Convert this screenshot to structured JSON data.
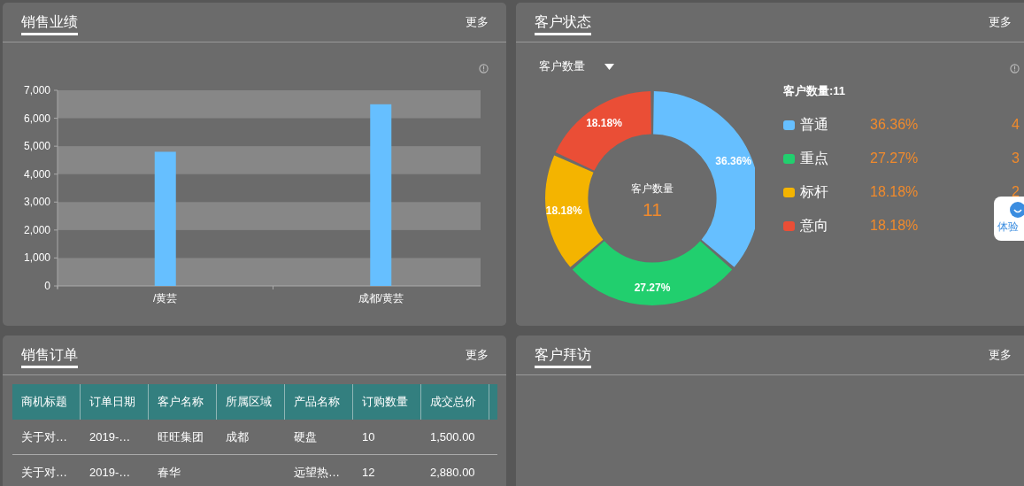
{
  "sales_performance": {
    "title": "销售业绩",
    "more": "更多",
    "chart_data": {
      "type": "bar",
      "categories": [
        "/黄芸",
        "成都/黄芸"
      ],
      "series": [
        {
          "color": "#66bfff",
          "values": [
            4800,
            6500
          ]
        }
      ],
      "ylim": [
        0,
        7000
      ],
      "yticks": [
        {
          "value": 0,
          "label": "0"
        },
        {
          "value": 1000,
          "label": "1,000"
        },
        {
          "value": 2000,
          "label": "2,000"
        },
        {
          "value": 3000,
          "label": "3,000"
        },
        {
          "value": 4000,
          "label": "4,000"
        },
        {
          "value": 5000,
          "label": "5,000"
        },
        {
          "value": 6000,
          "label": "6,000"
        },
        {
          "value": 7000,
          "label": "7,000"
        }
      ]
    }
  },
  "customer_status": {
    "title": "客户状态",
    "more": "更多",
    "dropdown": "客户数量",
    "center_label": "客户数量",
    "center_value": "11",
    "legend_title": "客户数量:11",
    "chart_data": {
      "type": "donut",
      "series": [
        {
          "values": [
            36.36,
            27.27,
            18.18,
            18.18
          ]
        }
      ],
      "value_labels": [
        "36.36%",
        "27.27%",
        "18.18%",
        "18.18%"
      ]
    },
    "legend": [
      {
        "label": "普通",
        "color": "#66bfff",
        "percent": "36.36%",
        "count": "4"
      },
      {
        "label": "重点",
        "color": "#21cf6e",
        "percent": "27.27%",
        "count": "3"
      },
      {
        "label": "标杆",
        "color": "#f4b400",
        "percent": "18.18%",
        "count": "2"
      },
      {
        "label": "意向",
        "color": "#ea4e36",
        "percent": "18.18%"
      }
    ]
  },
  "sales_orders": {
    "title": "销售订单",
    "more": "更多",
    "columns": [
      "商机标题",
      "订单日期",
      "客户名称",
      "所属区域",
      "产品名称",
      "订购数量",
      "成交总价"
    ],
    "rows": [
      [
        "关于对…",
        "2019-…",
        "旺旺集团",
        "成都",
        "硬盘",
        "10",
        "1,500.00"
      ],
      [
        "关于对…",
        "2019-…",
        "春华",
        "",
        "远望热…",
        "12",
        "2,880.00"
      ]
    ]
  },
  "customer_visits": {
    "title": "客户拜访",
    "more": "更多"
  },
  "helper_widget": {
    "label": "体验"
  }
}
